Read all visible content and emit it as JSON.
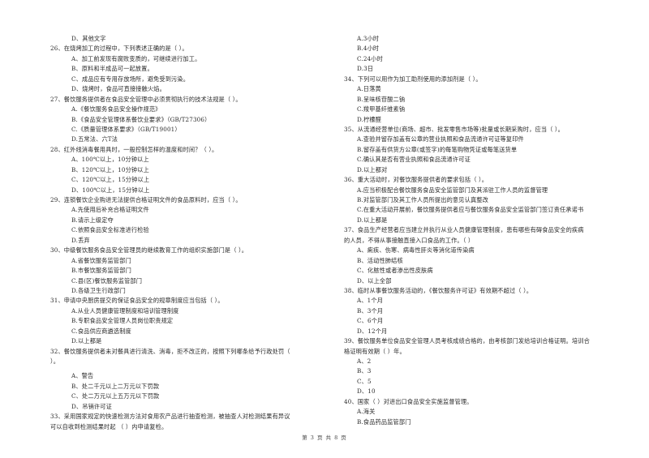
{
  "left_column": [
    {
      "type": "opt",
      "text": "D、其他文字"
    },
    {
      "type": "q",
      "text": "26、在烧烤加工的过程中，下列表述正确的是（    ）。"
    },
    {
      "type": "opt",
      "text": "A、加工前发现有腐败变质的，可继续进行加工。"
    },
    {
      "type": "opt",
      "text": "B、原料和半成品可一起放置。"
    },
    {
      "type": "opt",
      "text": "C、成品应有专用存放场所，避免受到污染。"
    },
    {
      "type": "opt",
      "text": "D、烧烤时，食品可直接接触火焰。"
    },
    {
      "type": "q",
      "text": "27、餐饮服务提供者在食品安全管理中必须贯彻执行的技术法规是（    ）。"
    },
    {
      "type": "opt",
      "text": "A.《餐饮服务食品安全操作规范》"
    },
    {
      "type": "opt",
      "text": "B.《食品安全管理体系餐饮业要求》（GB/T27306）"
    },
    {
      "type": "opt",
      "text": "C.《质量管理体系要求》（GB/T19001）"
    },
    {
      "type": "opt",
      "text": "D.五常法、六T法"
    },
    {
      "type": "q",
      "text": "28、红外线消毒餐用具时，一般控制怎样的温度和时间？（    ）。"
    },
    {
      "type": "opt",
      "text": "A、100℃以上，10分钟以上"
    },
    {
      "type": "opt",
      "text": "B、120℃以上，10分钟以上"
    },
    {
      "type": "opt",
      "text": "C、120℃以上，15分钟以上"
    },
    {
      "type": "opt",
      "text": "D、100℃以上，15分钟以上"
    },
    {
      "type": "q",
      "text": "29、连锁餐饮企业购进无法提供合格证明文件的食品原料时，应当（    ）。"
    },
    {
      "type": "opt",
      "text": "A.先使用后补充合格证明文件"
    },
    {
      "type": "opt",
      "text": "B.请示上级定夺"
    },
    {
      "type": "opt",
      "text": "C.依照食品安全标准进行检验"
    },
    {
      "type": "opt",
      "text": "D.丢弃"
    },
    {
      "type": "q",
      "text": "30、中级餐饮服务食品安全管理员的继续教育工作的组织实施部门是（    ）。"
    },
    {
      "type": "opt",
      "text": "A.省餐饮服务监管部门"
    },
    {
      "type": "opt",
      "text": "B.市餐饮服务监管部门"
    },
    {
      "type": "opt",
      "text": "C.县(区)餐饮服务监管部门"
    },
    {
      "type": "opt",
      "text": "D.各级卫生行政部门"
    },
    {
      "type": "q",
      "text": "31、申请中央厨房提交的保证食品安全的规章制度应当包括（    ）。"
    },
    {
      "type": "opt",
      "text": "A.从业人员健康管理制度和培训管理制度"
    },
    {
      "type": "opt",
      "text": "B.专职食品安全管理人员岗位职责规定"
    },
    {
      "type": "opt",
      "text": "C.食品供应商遴选制度"
    },
    {
      "type": "opt",
      "text": "D.以上都是"
    },
    {
      "type": "q",
      "text": "32、餐饮服务提供者未对餐具进行清洗、消毒，拒不改正的，按照下列哪条给予行政处罚（"
    },
    {
      "type": "q",
      "text": "）。"
    },
    {
      "type": "gap",
      "text": ""
    },
    {
      "type": "opt",
      "text": "A、警告"
    },
    {
      "type": "opt",
      "text": "B、处二千元以上二万元以下罚款"
    },
    {
      "type": "opt",
      "text": "C、处二万元以上五万元以下罚款"
    },
    {
      "type": "opt",
      "text": "D、吊销许可证"
    },
    {
      "type": "q",
      "text": "33、采用国家规定的快速检测方法对食用农产品进行抽查检测，被抽查人对检测结果有异议"
    },
    {
      "type": "q",
      "text": "可以自收到检测结果时起 （    ）内申请复检。"
    }
  ],
  "right_column": [
    {
      "type": "opt",
      "text": "A.3小时"
    },
    {
      "type": "opt",
      "text": "B.4小时"
    },
    {
      "type": "opt",
      "text": "C.24小时"
    },
    {
      "type": "opt",
      "text": "D.3日"
    },
    {
      "type": "q",
      "text": "34、下列可以用作为加工助剂使用的添加剂是（    ）。"
    },
    {
      "type": "opt",
      "text": "A.日落黄"
    },
    {
      "type": "opt",
      "text": "B.呈味核苷酸二钠"
    },
    {
      "type": "opt",
      "text": "C.羧甲基纤维素钠"
    },
    {
      "type": "opt",
      "text": "D.柠檬醛"
    },
    {
      "type": "q",
      "text": "35、从流通经营单位(商场、超市、批发零售市场等)批量或长期采购时，应当（    ）。"
    },
    {
      "type": "opt",
      "text": "A.查验并留存加盖有公章的营业执照和食品流通许可证等复印件"
    },
    {
      "type": "opt",
      "text": "B.留存盖有供货方公章(或签字)的每笔购物凭证或每笔送货单"
    },
    {
      "type": "opt",
      "text": "C.确认其是否有营业执照和食品流通许可证"
    },
    {
      "type": "opt",
      "text": "D.以上都对"
    },
    {
      "type": "q",
      "text": "36、重大活动时，对餐饮服务提供者的要求包括（    ）。"
    },
    {
      "type": "opt",
      "text": "A.应当积极配合餐饮服务食品安全监管部门及其派驻工作人员的监督管理"
    },
    {
      "type": "opt",
      "text": "B.对监管部门及其工作人员所提出的意见认真整改"
    },
    {
      "type": "opt",
      "text": "C.在重大活动开展前，餐饮服务提供者应与餐饮服务食品安全监管部门签订责任承诺书"
    },
    {
      "type": "opt",
      "text": "D.以上都是"
    },
    {
      "type": "q",
      "text": "37、食品生产经营者应当建立并执行从业人员健康管理制度，患有哪些有碍食品安全的疾病"
    },
    {
      "type": "q",
      "text": "的人员，不得从事接触直接入口食品的工作。（    ）"
    },
    {
      "type": "opt",
      "text": "A、痢疾、伤寒、病毒性肝炎等消化道传染病"
    },
    {
      "type": "opt",
      "text": "B、活动性肺结核"
    },
    {
      "type": "opt",
      "text": "C、化脓性或者渗出性皮肤病"
    },
    {
      "type": "opt",
      "text": "D、以上全部"
    },
    {
      "type": "q",
      "text": "38、临时从事餐饮服务活动的，《餐饮服务许可证》有效期不超过（    ）。"
    },
    {
      "type": "opt",
      "text": "A、1个月"
    },
    {
      "type": "opt",
      "text": "B、3个月"
    },
    {
      "type": "opt",
      "text": "C、6个月"
    },
    {
      "type": "opt",
      "text": "D、12个月"
    },
    {
      "type": "q",
      "text": "39、餐饮服务单位食品安全管理人员考核成绩合格的，由考核部门发给培训合格证明。培训合"
    },
    {
      "type": "q",
      "text": "格证明有效期（    ）年。"
    },
    {
      "type": "opt",
      "text": "A、2"
    },
    {
      "type": "opt",
      "text": "B、3"
    },
    {
      "type": "opt",
      "text": "C、5"
    },
    {
      "type": "opt",
      "text": "D、10"
    },
    {
      "type": "q",
      "text": "40、国家（    ）对进出口食品安全实施监督管理。"
    },
    {
      "type": "opt",
      "text": "A.海关"
    },
    {
      "type": "opt",
      "text": "B.食品药品监管部门"
    }
  ],
  "footer": {
    "page_label": "第 3 页 共 8 页"
  }
}
